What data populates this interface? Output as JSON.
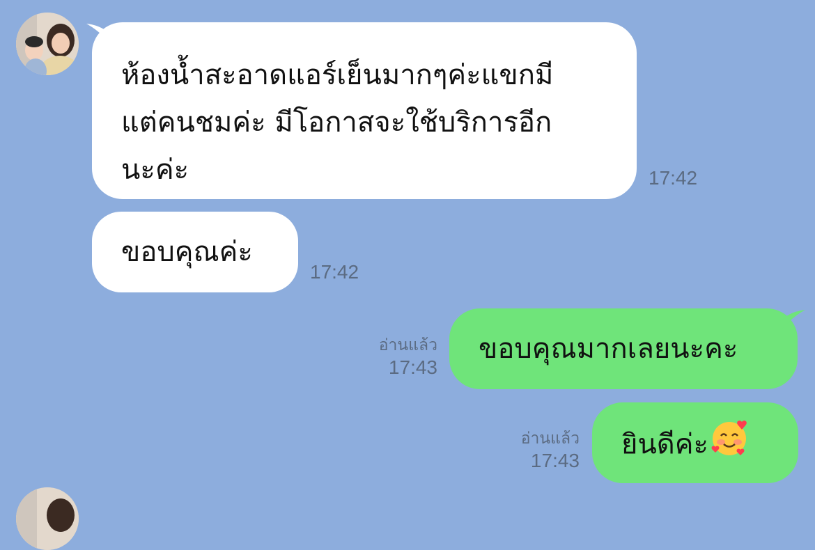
{
  "colors": {
    "background": "#8daddd",
    "incoming_bubble": "#ffffff",
    "outgoing_bubble": "#6fe47a",
    "meta_text": "#5b6b82"
  },
  "messages": [
    {
      "direction": "incoming",
      "lines": [
        "ห้องน้ำสะอาดแอร์เย็นมากๆค่ะแขกมี",
        "แต่คนชมค่ะ มีโอกาสจะใช้บริการอีก",
        "นะค่ะ"
      ],
      "time": "17:42"
    },
    {
      "direction": "incoming",
      "text": "ขอบคุณค่ะ",
      "time": "17:42"
    },
    {
      "direction": "outgoing",
      "text": "ขอบคุณมากเลยนะคะ",
      "read_label": "อ่านแล้ว",
      "time": "17:43"
    },
    {
      "direction": "outgoing",
      "text": "ยินดีค่ะ",
      "emoji": "smiling-face-with-hearts-icon",
      "read_label": "อ่านแล้ว",
      "time": "17:43"
    }
  ]
}
